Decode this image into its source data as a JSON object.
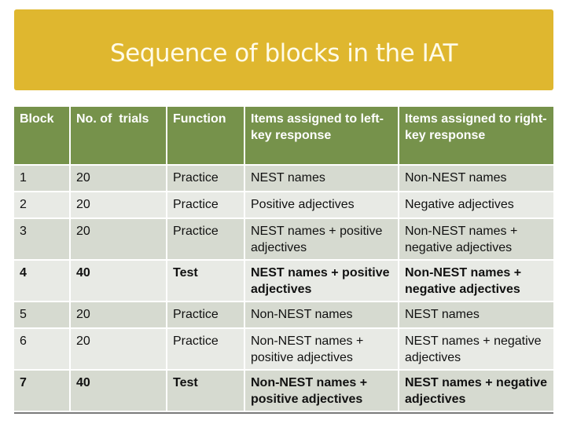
{
  "title": "Sequence of blocks in the IAT",
  "colors": {
    "title_bar": "#dfb72f",
    "header": "#76924b",
    "row_odd": "#d6dad0",
    "row_even": "#e8eae5"
  },
  "table": {
    "headers": [
      "Block",
      "No. of  trials",
      "Function",
      "Items assigned to left-key response",
      "Items assigned to right-key response"
    ],
    "rows": [
      {
        "block": "1",
        "trials": "20",
        "function": "Practice",
        "left": "NEST names",
        "right": "Non-NEST names",
        "bold": false
      },
      {
        "block": "2",
        "trials": "20",
        "function": "Practice",
        "left": "Positive adjectives",
        "right": "Negative adjectives",
        "bold": false
      },
      {
        "block": "3",
        "trials": "20",
        "function": "Practice",
        "left": "NEST names + positive adjectives",
        "right": "Non-NEST names + negative adjectives",
        "bold": false
      },
      {
        "block": "4",
        "trials": "40",
        "function": "Test",
        "left": "NEST names + positive adjectives",
        "right": "Non-NEST names + negative adjectives",
        "bold": true
      },
      {
        "block": "5",
        "trials": "20",
        "function": "Practice",
        "left": "Non-NEST names",
        "right": "NEST names",
        "bold": false
      },
      {
        "block": "6",
        "trials": "20",
        "function": "Practice",
        "left": "Non-NEST names + positive adjectives",
        "right": "NEST names + negative adjectives",
        "bold": false
      },
      {
        "block": "7",
        "trials": "40",
        "function": "Test",
        "left": "Non-NEST names + positive adjectives",
        "right": "NEST names + negative adjectives",
        "bold": true
      }
    ]
  }
}
